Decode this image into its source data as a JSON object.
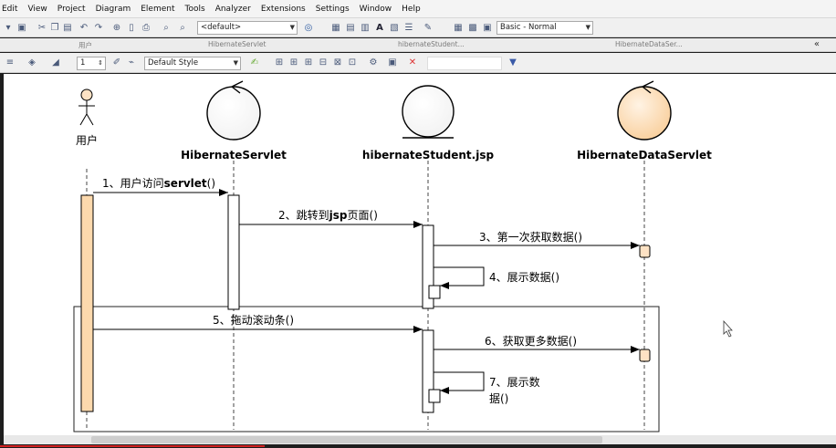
{
  "menu": [
    "Edit",
    "View",
    "Project",
    "Diagram",
    "Element",
    "Tools",
    "Analyzer",
    "Extensions",
    "Settings",
    "Window",
    "Help"
  ],
  "toolbar": {
    "default_combo": "<default>",
    "style_combo": "Basic - Normal"
  },
  "tabs": [
    "用户",
    "HibernateServlet",
    "hibernateStudent...",
    "HibernateDataSer..."
  ],
  "format_toolbar": {
    "line_width": "1",
    "style_combo": "Default Style"
  },
  "diagram": {
    "lifelines": [
      {
        "id": "user",
        "name": "用户",
        "kind": "actor"
      },
      {
        "id": "servlet",
        "name": "HibernateServlet",
        "kind": "control"
      },
      {
        "id": "jsp",
        "name": "hibernateStudent.jsp",
        "kind": "entity"
      },
      {
        "id": "data",
        "name": "HibernateDataServlet",
        "kind": "control"
      }
    ],
    "messages": [
      {
        "num": "1、",
        "text_cn": "用户访问",
        "text_bold": "servlet",
        "text_end": "()"
      },
      {
        "num": "2、",
        "text_cn": "跳转到",
        "text_bold": "jsp",
        "text_end": "页面()"
      },
      {
        "num": "3、",
        "text_cn": "第一次获取数据()",
        "text_bold": "",
        "text_end": ""
      },
      {
        "num": "4、",
        "text_cn": "展示数据()",
        "text_bold": "",
        "text_end": ""
      },
      {
        "num": "5、",
        "text_cn": "拖动滚动条()",
        "text_bold": "",
        "text_end": ""
      },
      {
        "num": "6、",
        "text_cn": "获取更多数据()",
        "text_bold": "",
        "text_end": ""
      },
      {
        "num": "7、",
        "text_cn": "展示数",
        "text_bold": "",
        "text_end": ""
      },
      {
        "num": "",
        "text_cn": "据()",
        "text_bold": "",
        "text_end": ""
      }
    ]
  },
  "colors": {
    "canvas_bg": "#ffffff",
    "activation_user": "#fcd9ad",
    "lifeline_head_data": "#fde2c4",
    "arrow": "#000000"
  },
  "icons": [
    "save-icon",
    "cut-icon",
    "copy-icon",
    "paste-icon",
    "undo-icon",
    "redo-icon",
    "zoom-icon",
    "print-icon",
    "search-icon",
    "filter-icon",
    "delete-icon",
    "collapse-icon"
  ]
}
